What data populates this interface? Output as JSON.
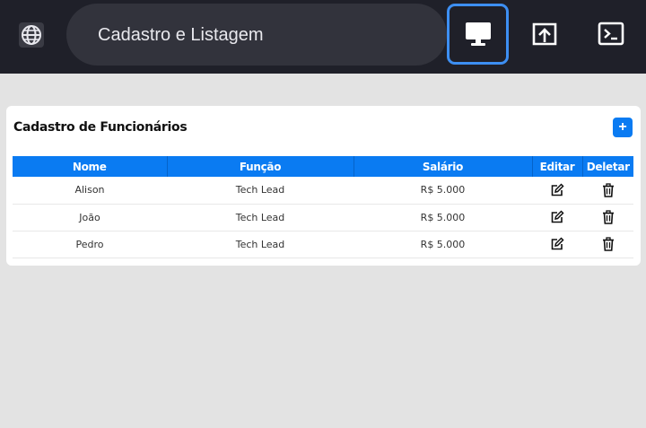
{
  "topbar": {
    "title": "Cadastro e Listagem",
    "buttons": [
      {
        "icon": "monitor-icon",
        "active": true
      },
      {
        "icon": "upload-box-icon",
        "active": false
      },
      {
        "icon": "terminal-icon",
        "active": false
      }
    ],
    "globe_icon": "globe-icon",
    "accent_color": "#3d8ff3"
  },
  "card": {
    "title": "Cadastro de Funcionários",
    "add_label": "+",
    "header_color": "#0a7bf2"
  },
  "table": {
    "columns": [
      "Nome",
      "Função",
      "Salário",
      "Editar",
      "Deletar"
    ],
    "rows": [
      {
        "nome": "Alison",
        "funcao": "Tech Lead",
        "salario": "R$ 5.000"
      },
      {
        "nome": "João",
        "funcao": "Tech Lead",
        "salario": "R$ 5.000"
      },
      {
        "nome": "Pedro",
        "funcao": "Tech Lead",
        "salario": "R$ 5.000"
      }
    ]
  }
}
